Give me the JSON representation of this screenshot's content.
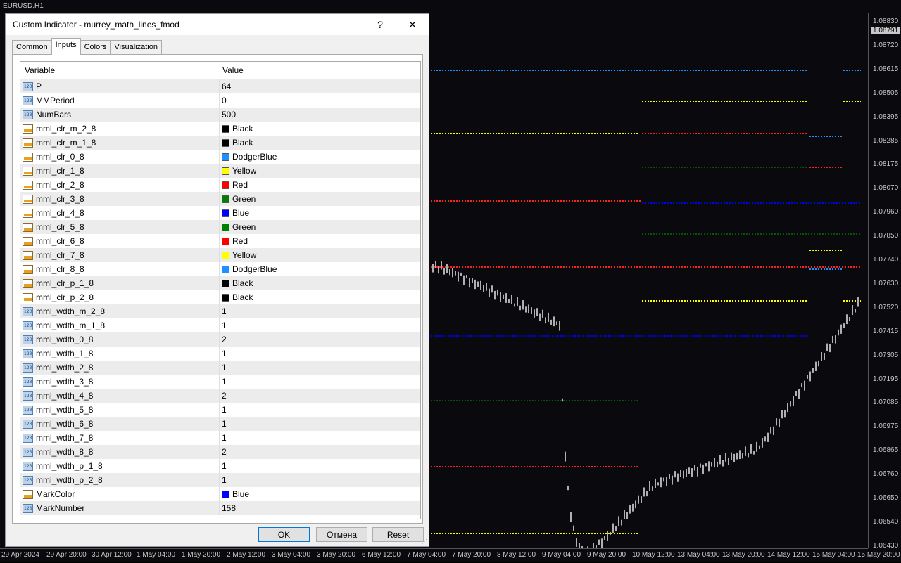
{
  "chart": {
    "symbol_title": "EURUSD,H1",
    "current_price": "1.08791",
    "price_ticks": [
      "1.08830",
      "1.08720",
      "1.08615",
      "1.08505",
      "1.08395",
      "1.08285",
      "1.08175",
      "1.08070",
      "1.07960",
      "1.07850",
      "1.07740",
      "1.07630",
      "1.07520",
      "1.07415",
      "1.07305",
      "1.07195",
      "1.07085",
      "1.06975",
      "1.06865",
      "1.06760",
      "1.06650",
      "1.06540",
      "1.06430"
    ],
    "time_ticks": [
      "29 Apr 2024",
      "29 Apr 20:00",
      "30 Apr 12:00",
      "1 May 04:00",
      "1 May 20:00",
      "2 May 12:00",
      "3 May 04:00",
      "3 May 20:00",
      "6 May 12:00",
      "7 May 04:00",
      "7 May 20:00",
      "8 May 12:00",
      "9 May 04:00",
      "9 May 20:00",
      "10 May 12:00",
      "13 May 04:00",
      "13 May 20:00",
      "14 May 12:00",
      "15 May 04:00",
      "15 May 20:00"
    ],
    "colors": {
      "dodgerblue": "#1e90ff",
      "yellow": "#ffff00",
      "red": "#ff2020",
      "green": "#00a000",
      "blue": "#0000ff",
      "candle": "#b0b0b0"
    }
  },
  "dialog": {
    "title": "Custom Indicator - murrey_math_lines_fmod",
    "help_label": "?",
    "close_label": "✕",
    "tabs": [
      "Common",
      "Inputs",
      "Colors",
      "Visualization"
    ],
    "active_tab": "Inputs",
    "columns": {
      "variable": "Variable",
      "value": "Value"
    },
    "rows": [
      {
        "icon": "numeric-icon",
        "name": "P",
        "value": "64"
      },
      {
        "icon": "numeric-icon",
        "name": "MMPeriod",
        "value": "0"
      },
      {
        "icon": "numeric-icon",
        "name": "NumBars",
        "value": "500"
      },
      {
        "icon": "color-icon",
        "name": "mml_clr_m_2_8",
        "value": "Black",
        "swatch": "#000000"
      },
      {
        "icon": "color-icon",
        "name": "mml_clr_m_1_8",
        "value": "Black",
        "swatch": "#000000"
      },
      {
        "icon": "color-icon",
        "name": "mml_clr_0_8",
        "value": "DodgerBlue",
        "swatch": "#1e90ff"
      },
      {
        "icon": "color-icon",
        "name": "mml_clr_1_8",
        "value": "Yellow",
        "swatch": "#ffff00"
      },
      {
        "icon": "color-icon",
        "name": "mml_clr_2_8",
        "value": "Red",
        "swatch": "#ff0000"
      },
      {
        "icon": "color-icon",
        "name": "mml_clr_3_8",
        "value": "Green",
        "swatch": "#008000"
      },
      {
        "icon": "color-icon",
        "name": "mml_clr_4_8",
        "value": "Blue",
        "swatch": "#0000ff"
      },
      {
        "icon": "color-icon",
        "name": "mml_clr_5_8",
        "value": "Green",
        "swatch": "#008000"
      },
      {
        "icon": "color-icon",
        "name": "mml_clr_6_8",
        "value": "Red",
        "swatch": "#ff0000"
      },
      {
        "icon": "color-icon",
        "name": "mml_clr_7_8",
        "value": "Yellow",
        "swatch": "#ffff00"
      },
      {
        "icon": "color-icon",
        "name": "mml_clr_8_8",
        "value": "DodgerBlue",
        "swatch": "#1e90ff"
      },
      {
        "icon": "color-icon",
        "name": "mml_clr_p_1_8",
        "value": "Black",
        "swatch": "#000000"
      },
      {
        "icon": "color-icon",
        "name": "mml_clr_p_2_8",
        "value": "Black",
        "swatch": "#000000"
      },
      {
        "icon": "numeric-icon",
        "name": "mml_wdth_m_2_8",
        "value": "1"
      },
      {
        "icon": "numeric-icon",
        "name": "mml_wdth_m_1_8",
        "value": "1"
      },
      {
        "icon": "numeric-icon",
        "name": "mml_wdth_0_8",
        "value": "2"
      },
      {
        "icon": "numeric-icon",
        "name": "mml_wdth_1_8",
        "value": "1"
      },
      {
        "icon": "numeric-icon",
        "name": "mml_wdth_2_8",
        "value": "1"
      },
      {
        "icon": "numeric-icon",
        "name": "mml_wdth_3_8",
        "value": "1"
      },
      {
        "icon": "numeric-icon",
        "name": "mml_wdth_4_8",
        "value": "2"
      },
      {
        "icon": "numeric-icon",
        "name": "mml_wdth_5_8",
        "value": "1"
      },
      {
        "icon": "numeric-icon",
        "name": "mml_wdth_6_8",
        "value": "1"
      },
      {
        "icon": "numeric-icon",
        "name": "mml_wdth_7_8",
        "value": "1"
      },
      {
        "icon": "numeric-icon",
        "name": "mml_wdth_8_8",
        "value": "2"
      },
      {
        "icon": "numeric-icon",
        "name": "mml_wdth_p_1_8",
        "value": "1"
      },
      {
        "icon": "numeric-icon",
        "name": "mml_wdth_p_2_8",
        "value": "1"
      },
      {
        "icon": "color-icon",
        "name": "MarkColor",
        "value": "Blue",
        "swatch": "#0000ff"
      },
      {
        "icon": "numeric-icon",
        "name": "MarkNumber",
        "value": "158"
      }
    ],
    "buttons": {
      "ok": "OK",
      "cancel": "Отмена",
      "reset": "Reset"
    }
  }
}
